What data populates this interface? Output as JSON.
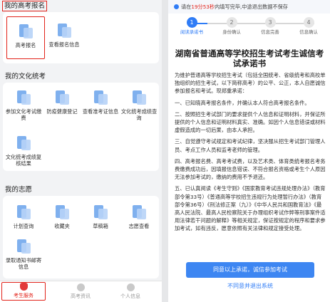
{
  "left": {
    "sections": [
      {
        "title": "我的高考报名",
        "items": [
          {
            "label": "高考报名"
          },
          {
            "label": "查看报名信息"
          }
        ]
      },
      {
        "title": "我的文化统考",
        "items": [
          {
            "label": "参加文化考试缴费"
          },
          {
            "label": "防疫健康登记"
          },
          {
            "label": "查看准考证信息"
          },
          {
            "label": "文化统考成绩查询"
          },
          {
            "label": "文化统考成绩复核结果"
          }
        ]
      },
      {
        "title": "我的志愿",
        "items": [
          {
            "label": "计划查询"
          },
          {
            "label": "收藏夹"
          },
          {
            "label": "草稿箱"
          },
          {
            "label": "志愿查看"
          },
          {
            "label": "录取通知书邮寄信息"
          }
        ]
      }
    ],
    "tabs": [
      {
        "label": "考生服务"
      },
      {
        "label": "高考资讯"
      },
      {
        "label": "个人信息"
      }
    ]
  },
  "right": {
    "notice": {
      "prefix": "请在",
      "time": "19分53秒",
      "suffix": "内填写完毕,中途退出数据不保存"
    },
    "steps": [
      {
        "num": "1",
        "label": "阅读承诺书"
      },
      {
        "num": "2",
        "label": "身份确认"
      },
      {
        "num": "3",
        "label": "信息完善"
      },
      {
        "num": "4",
        "label": "信息确认"
      }
    ],
    "title": "湖南省普通高等学校招生考试考生诚信考试承诺书",
    "paragraphs": [
      "为维护普通高等学校招生考试（包括全国统考、省级统考和高校单独组织的招生考试，以下简称高考）的公平、公正，本人自愿诚信参加报名和考试。现郑重承诺：",
      "一、已知晓高考报名条件，并确认本人符合高考报名条件。",
      "二、按照招生考试部门的要求提供个人信息和证明材料，并保证所提供的个人信息和证明材料真实、准确。如因个人信息错误或材料虚假造成的一切后果，由本人承担。",
      "三、自觉遵守考试规定和考试纪律，坚决服从招生考试部门管理人员、考点工作人员和监考老师的管理。",
      "四、高考报名费、高考考试费，以及艺术类、体育类统考报名考务费缴费成功后，因填报信息错误、不符合报名资格或考生个人原因无法参加考试的，缴纳的费用不予退还。",
      "五、已认真阅读《考生守则》《国家教育考试违规处理办法》（教育部令第33号）《普通高等学校招生违规行为处理暂行办法》（教育部令第36号）《刑法修正案（九）》《中华人民共和国教育法》《最高人民法院、最高人民检察院关于办理组织考试作弊等刑事案件适用法律若干问题的解释》等相关规定，保证按规定的程序和要求参加考试，如有违反，愿意依照有关法律和规定接受处理。"
    ],
    "agree_label": "同意以上承诺，诚信参加考试",
    "disagree_label": "不同意并退出系统"
  }
}
